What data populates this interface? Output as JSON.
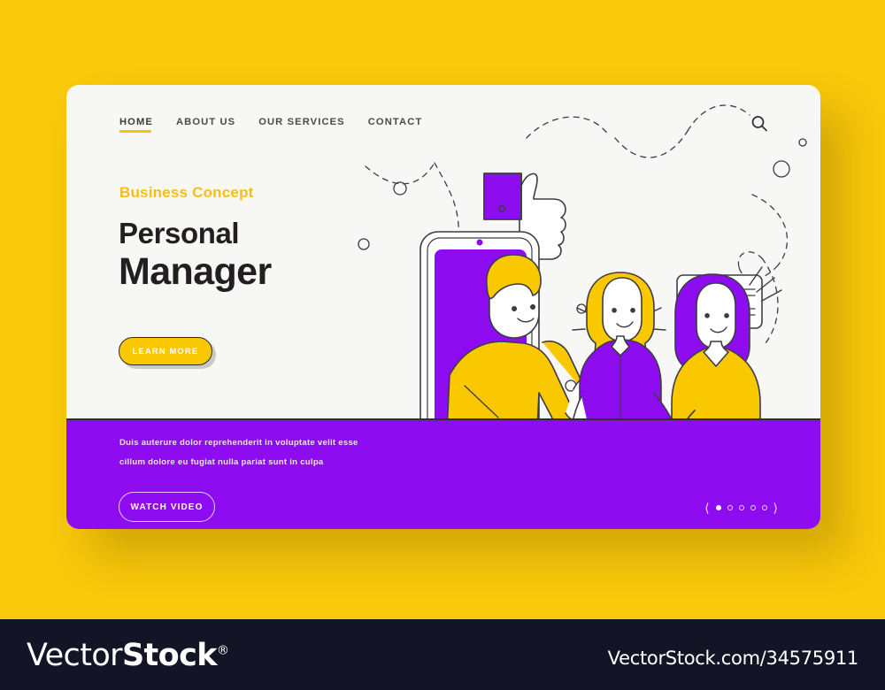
{
  "page": {
    "background_color": "#f8c80a",
    "card_background": "#f7f7f5",
    "accent_yellow": "#fac800",
    "accent_purple": "#8d0cf0",
    "ink": "#231f20"
  },
  "nav": {
    "items": [
      {
        "label": "HOME",
        "active": true
      },
      {
        "label": "ABOUT US",
        "active": false
      },
      {
        "label": "OUR SERVICES",
        "active": false
      },
      {
        "label": "CONTACT",
        "active": false
      }
    ],
    "search_icon": "search-icon"
  },
  "hero": {
    "eyebrow": "Business Concept",
    "title_line1": "Personal",
    "title_line2": "Manager",
    "cta_label": "LEARN MORE"
  },
  "band": {
    "text_line1": "Duis auterure dolor reprehenderit in voluptate velit esse",
    "text_line2": "cillum dolore eu fugiat nulla pariat sunt in culpa",
    "button_label": "WATCH VIDEO",
    "pager": {
      "prev_icon": "chevron-left-icon",
      "next_icon": "chevron-right-icon",
      "total_dots": 5,
      "active_index": 0
    }
  },
  "illustration": {
    "alt": "three people with smartphone, lightbulb, thumbs up and chat bubble",
    "elements": [
      "smartphone",
      "man-yellow-sweater",
      "woman-purple-shirt",
      "woman-yellow-dress",
      "lightbulb-icon",
      "thumbs-up-icon",
      "chat-bubble-icon",
      "dashed-paths",
      "decorative-circles"
    ]
  },
  "footer": {
    "logo_part1": "Vector",
    "logo_part2": "Stock",
    "logo_registered": "®",
    "url": "VectorStock.com/34575911"
  }
}
